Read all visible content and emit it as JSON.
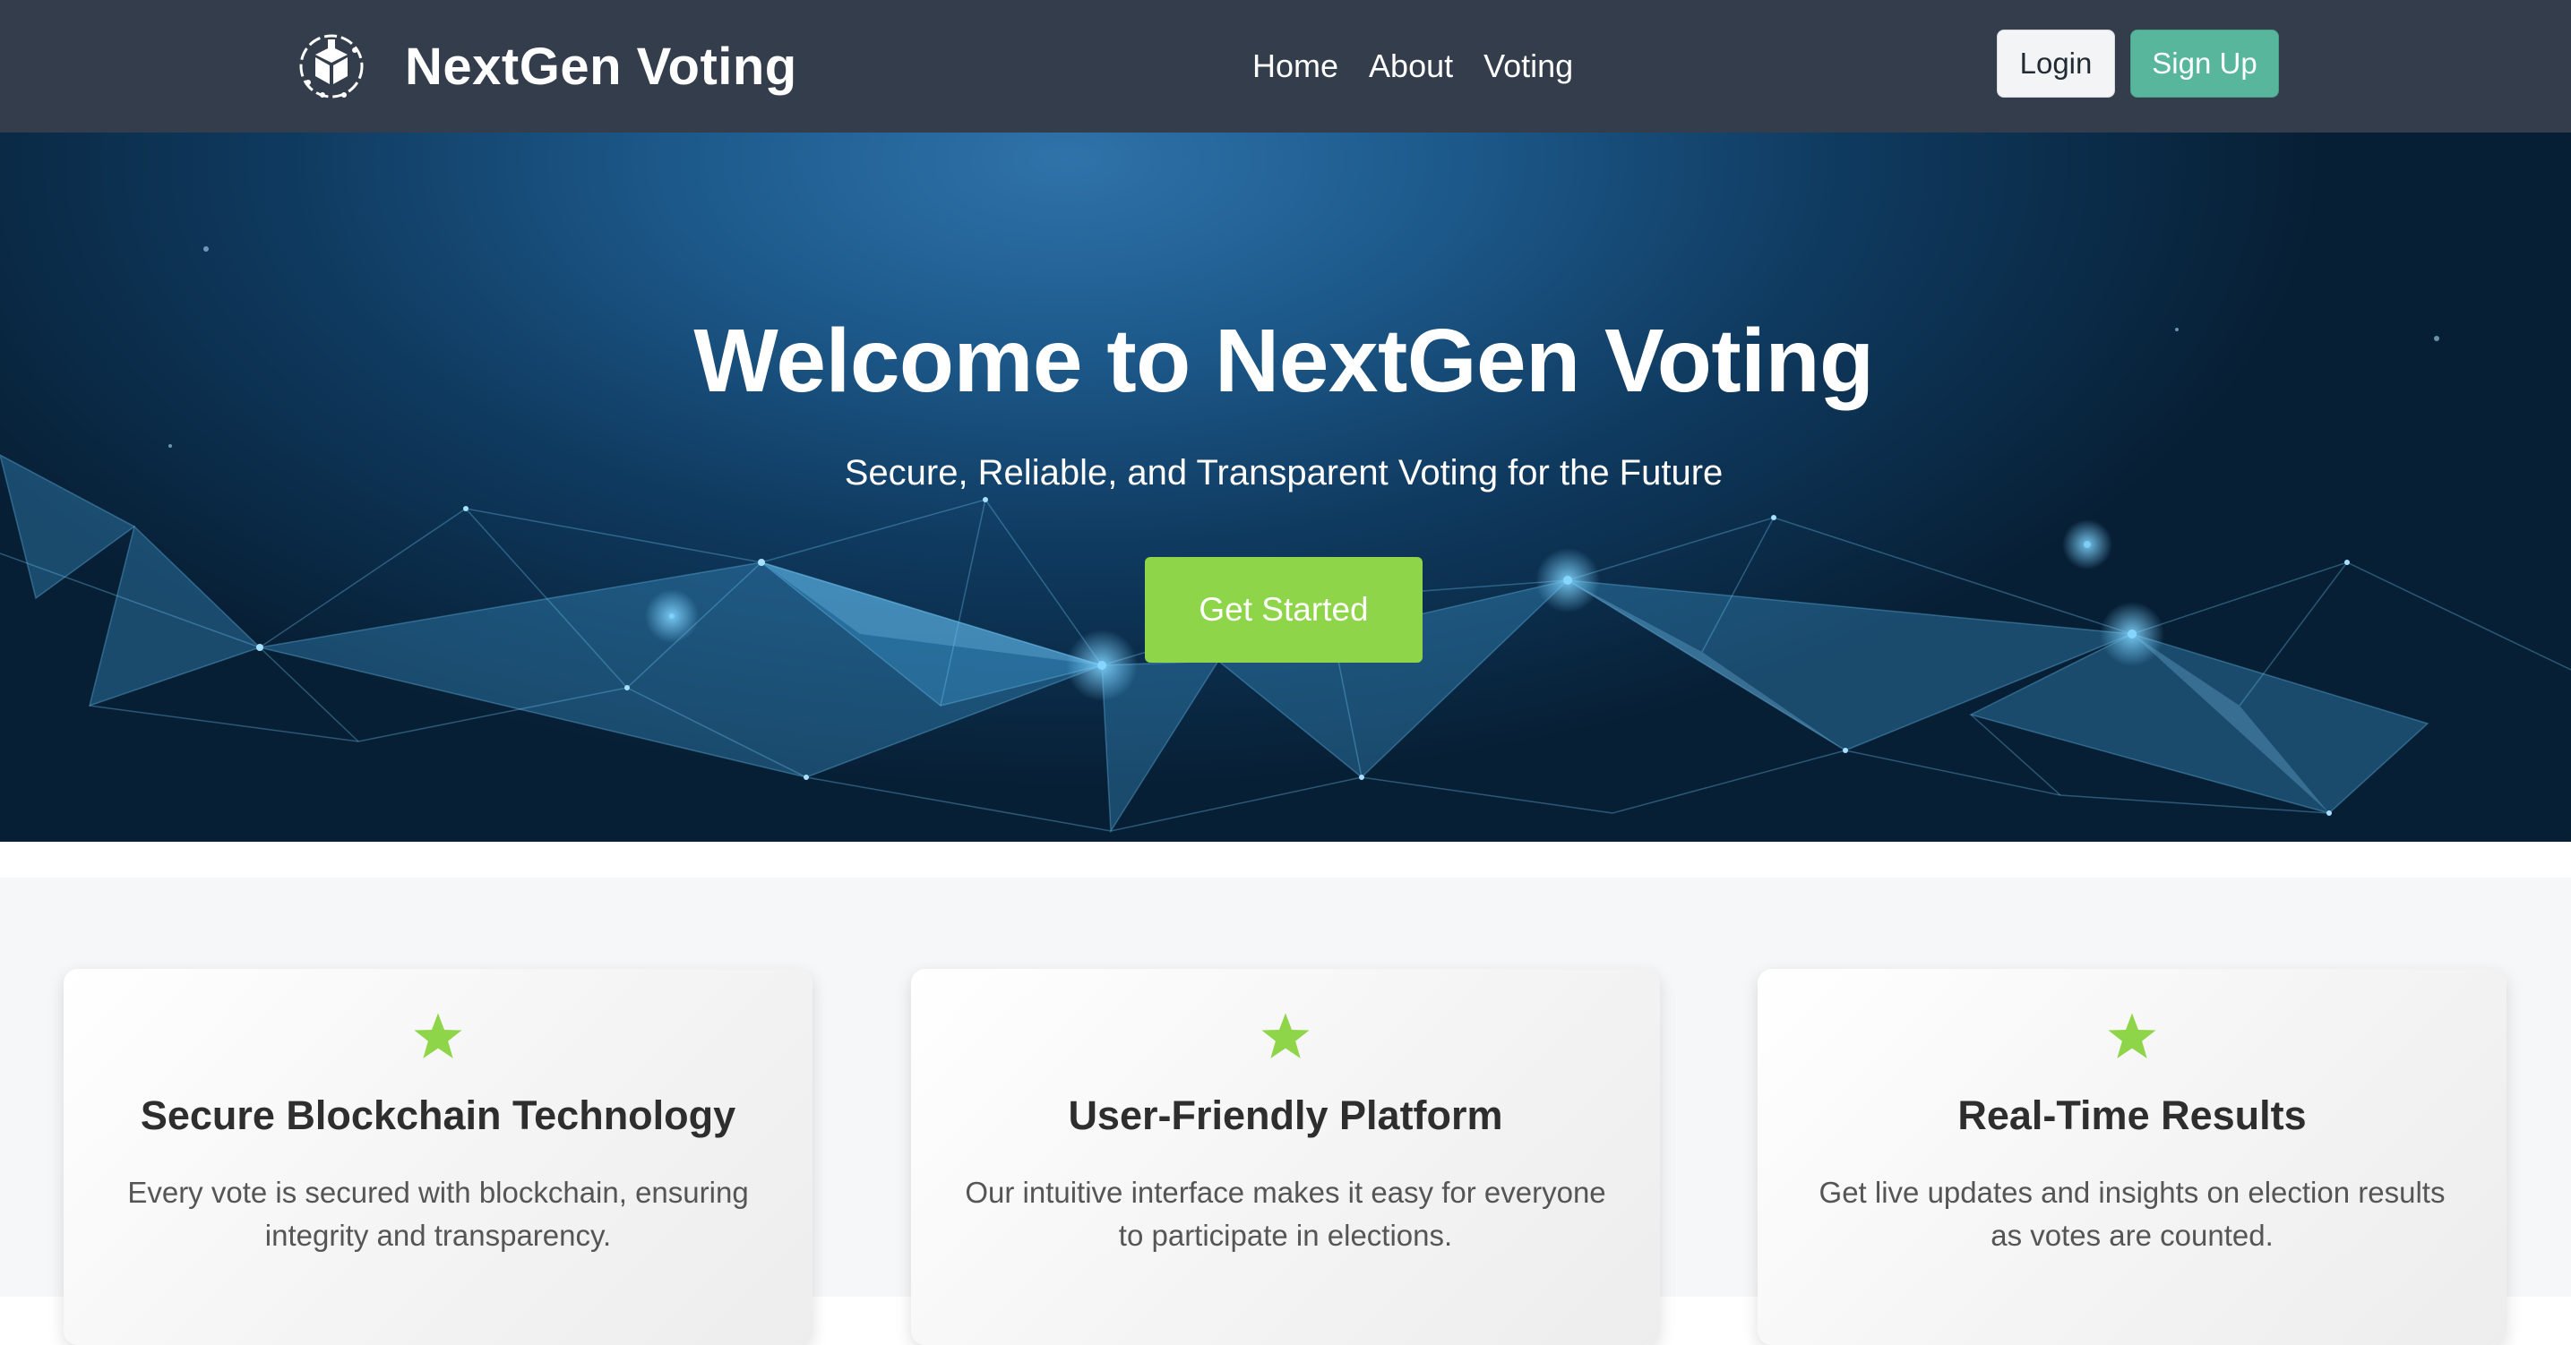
{
  "navbar": {
    "brand": "NextGen Voting",
    "logo_icon": "ballot-box-circuit-icon",
    "links": [
      "Home",
      "About",
      "Voting"
    ],
    "login_label": "Login",
    "signup_label": "Sign Up"
  },
  "hero": {
    "title": "Welcome to NextGen Voting",
    "subtitle": "Secure, Reliable, and Transparent Voting for the Future",
    "cta_label": "Get Started"
  },
  "features": [
    {
      "icon": "star-icon",
      "title": "Secure Blockchain Technology",
      "text": "Every vote is secured with blockchain, ensuring integrity and transparency."
    },
    {
      "icon": "star-icon",
      "title": "User-Friendly Platform",
      "text": "Our intuitive interface makes it easy for everyone to participate in elections."
    },
    {
      "icon": "star-icon",
      "title": "Real-Time Results",
      "text": "Get live updates and insights on election results as votes are counted."
    }
  ],
  "colors": {
    "navbar_bg": "#333d4b",
    "signup_bg": "#57b69c",
    "cta_bg": "#8fd549",
    "star": "#8fd549",
    "hero_blue": "#1d5a8c",
    "features_bg": "#f6f7f9"
  }
}
